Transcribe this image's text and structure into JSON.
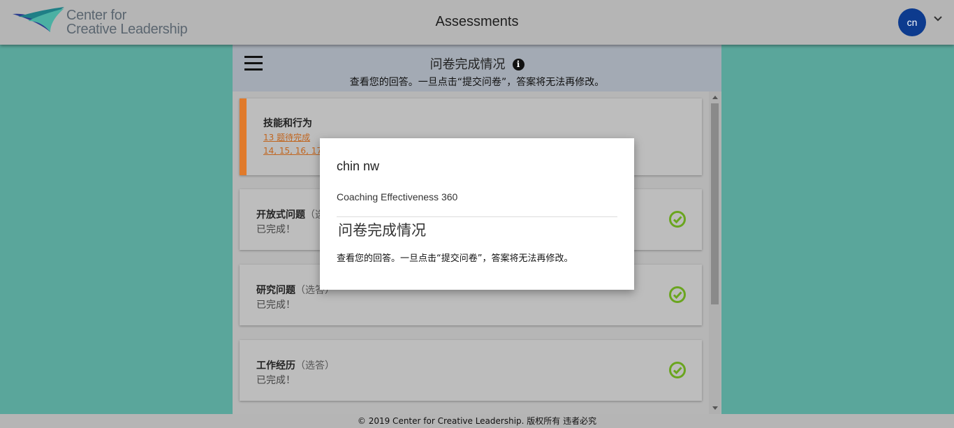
{
  "header": {
    "logo_line1": "Center for",
    "logo_line2": "Creative Leadership",
    "title": "Assessments",
    "avatar_initials": "cn"
  },
  "panel": {
    "title": "问卷完成情况",
    "subtitle": "查看您的回答。一旦点击“提交问卷”，答案将无法再修改。"
  },
  "cards": [
    {
      "title": "技能和行为",
      "pending": "13 题待完成",
      "items": "14, 15, 16, 17"
    },
    {
      "title": "开放式问题",
      "optional": "（选答）",
      "status": "已完成！"
    },
    {
      "title": "研究问题",
      "optional": "（选答）",
      "status": "已完成！"
    },
    {
      "title": "工作经历",
      "optional": "（选答）",
      "status": "已完成！"
    }
  ],
  "modal": {
    "name": "chin nw",
    "assessment": "Coaching Effectiveness 360",
    "title": "问卷完成情况",
    "description": "查看您的回答。一旦点击“提交问卷”，答案将无法再修改。"
  },
  "footer": {
    "text": "© 2019 Center for Creative Leadership. 版权所有 违者必究"
  },
  "colors": {
    "accent_orange": "#e07a2b",
    "check_green": "#6aa51f",
    "avatar_blue": "#0d3b8e"
  }
}
